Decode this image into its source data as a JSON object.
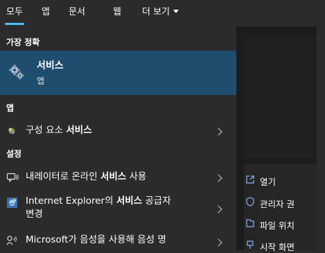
{
  "tabs": [
    {
      "label": "모두"
    },
    {
      "label": "앱"
    },
    {
      "label": "문서"
    },
    {
      "label": "웹"
    },
    {
      "label": "더 보기"
    }
  ],
  "sections": {
    "best_match": "가장 정확",
    "apps": "앱",
    "settings": "설정"
  },
  "best_match": {
    "title": "서비스",
    "subtitle": "앱",
    "icon": "gears-icon"
  },
  "results": [
    {
      "prefix": "구성 요소 ",
      "bold": "서비스",
      "suffix": "",
      "line2": "",
      "icon": "component-services-icon"
    },
    {
      "prefix": "내레이터로 온라인 ",
      "bold": "서비스",
      "suffix": " 사용",
      "line2": "",
      "icon": "narrator-icon"
    },
    {
      "prefix": "Internet Explorer의 ",
      "bold": "서비스",
      "suffix": " 공급자",
      "line2": "변경",
      "icon": "internet-options-icon"
    },
    {
      "prefix": "Microsoft가 음성을 사용해 음성 명",
      "bold": "",
      "suffix": "",
      "line2": "",
      "icon": "speech-icon"
    }
  ],
  "actions": [
    {
      "label": "열기",
      "icon": "open-icon"
    },
    {
      "label": "관리자 권",
      "icon": "shield-icon"
    },
    {
      "label": "파일 위치",
      "icon": "folder-icon"
    },
    {
      "label": "시작 화면",
      "icon": "pin-icon"
    }
  ],
  "colors": {
    "background": "#2b2b2b",
    "selected": "#1f4d6e",
    "accent": "#4cc2ff",
    "pane": "#1c1c1c"
  }
}
